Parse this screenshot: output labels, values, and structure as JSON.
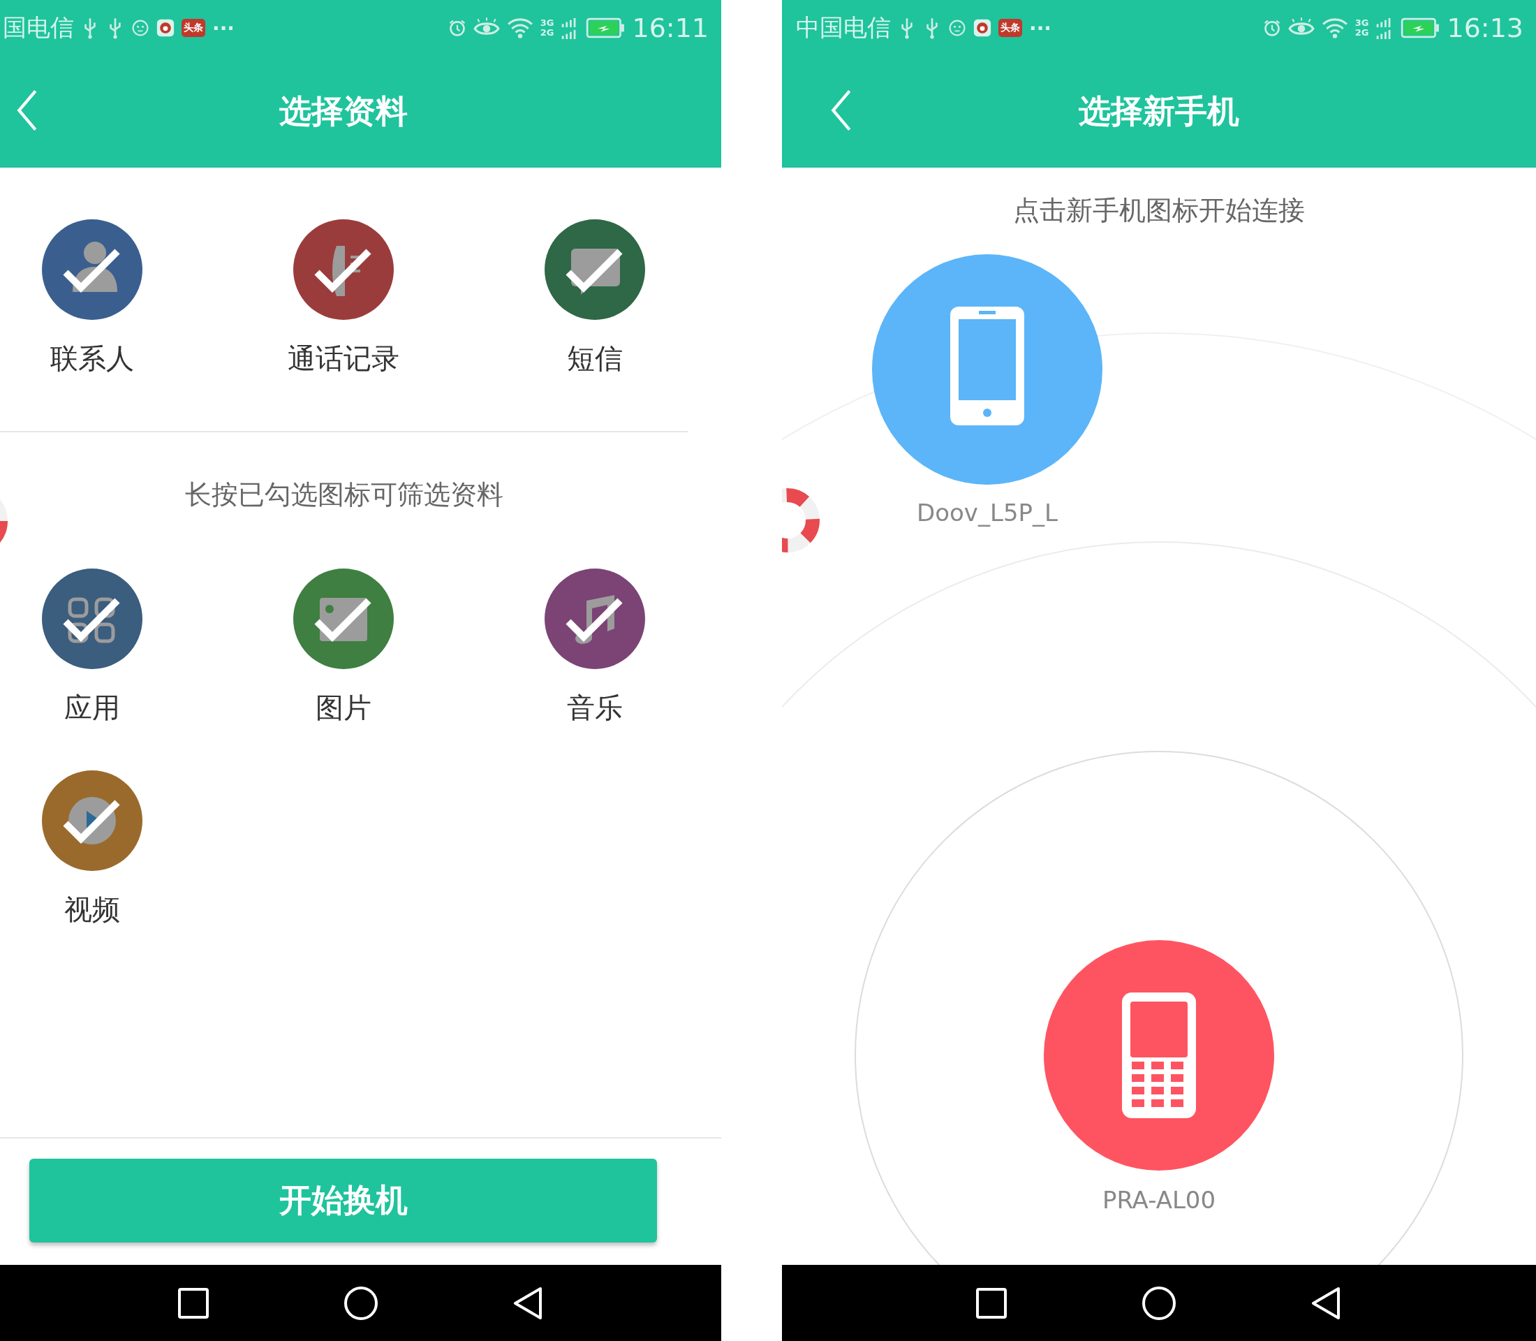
{
  "screens": [
    {
      "status_bar": {
        "carrier": "国电信",
        "badge": "头条",
        "more": "···",
        "network_types": [
          "3G",
          "2G"
        ],
        "time": "16:11"
      },
      "header": {
        "title": "选择资料"
      },
      "sections": [
        {
          "items": [
            {
              "kind": "contacts",
              "label": "联系人",
              "color": "#3a5f8f",
              "checked": true
            },
            {
              "kind": "calls",
              "label": "通话记录",
              "color": "#9b3c3c",
              "checked": true
            },
            {
              "kind": "messages",
              "label": "短信",
              "color": "#2e6846",
              "checked": true
            }
          ]
        },
        {
          "hint": "长按已勾选图标可筛选资料",
          "items": [
            {
              "kind": "apps",
              "label": "应用",
              "color": "#3b5d7e",
              "checked": true
            },
            {
              "kind": "photos",
              "label": "图片",
              "color": "#3f7f41",
              "checked": true
            },
            {
              "kind": "music",
              "label": "音乐",
              "color": "#7b4475",
              "checked": true
            },
            {
              "kind": "video",
              "label": "视频",
              "color": "#9a6a2c",
              "checked": true
            }
          ]
        }
      ],
      "action_button": "开始换机"
    },
    {
      "status_bar": {
        "carrier": "中国电信",
        "badge": "头条",
        "more": "···",
        "network_types": [
          "3G",
          "2G"
        ],
        "time": "16:13"
      },
      "header": {
        "title": "选择新手机"
      },
      "hint": "点击新手机图标开始连接",
      "devices": [
        {
          "kind": "target",
          "name": "Doov_L5P_L",
          "color": "#5bb5f8"
        },
        {
          "kind": "self",
          "name": "PRA-AL00",
          "color": "#fe5461"
        }
      ]
    }
  ]
}
